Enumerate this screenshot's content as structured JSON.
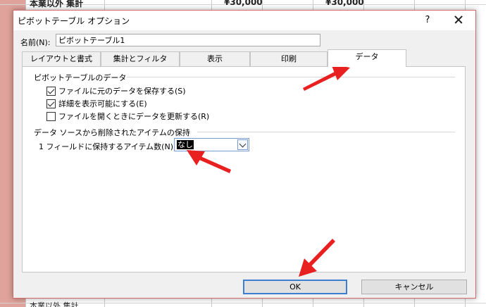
{
  "background_sheet": {
    "top_row_left_text": "本業以外 集計",
    "top_row_value_1": "¥30,000",
    "top_row_value_2": "¥30,000",
    "bottom_row_text": "本業以外 集計"
  },
  "dialog": {
    "title": "ピボットテーブル オプション",
    "help_label": "?",
    "name_label": "名前(N):",
    "name_value": "ピボットテーブル1",
    "tabs": [
      {
        "label": "レイアウトと書式",
        "active": false
      },
      {
        "label": "集計とフィルタ",
        "active": false
      },
      {
        "label": "表示",
        "active": false
      },
      {
        "label": "印刷",
        "active": false
      },
      {
        "label": "データ",
        "active": true
      }
    ],
    "pivot_data_group": {
      "title": "ピボットテーブルのデータ",
      "options": [
        {
          "label": "ファイルに元のデータを保存する(S)",
          "checked": true
        },
        {
          "label": "詳細を表示可能にする(E)",
          "checked": true
        },
        {
          "label": "ファイルを開くときにデータを更新する(R)",
          "checked": false
        }
      ]
    },
    "retain_group": {
      "title": "データ ソースから削除されたアイテムの保持",
      "items_label": "1 フィールドに保持するアイテム数(N):",
      "items_value": "なし"
    },
    "ok_label": "OK",
    "cancel_label": "キャンセル"
  },
  "colors": {
    "accent_border": "#3c7fd1",
    "annotation_arrow": "#e8201f",
    "sheet_left_fill": "#e0a39b"
  }
}
